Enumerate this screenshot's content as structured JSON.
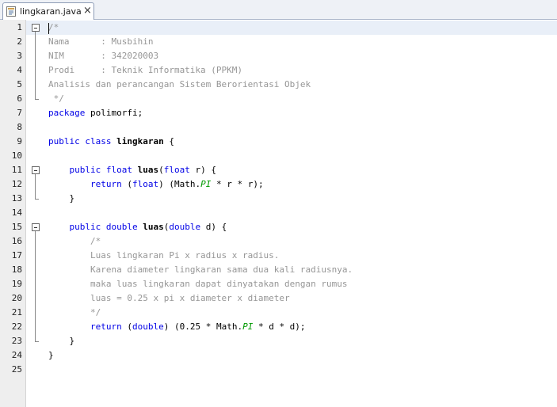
{
  "tab": {
    "filename": "lingkaran.java",
    "close_symbol": "×",
    "icon": "java-file-icon"
  },
  "editor": {
    "current_line": 1,
    "lines": [
      {
        "n": "1",
        "html": "<span class=\"cm\">/*</span>"
      },
      {
        "n": "2",
        "html": "<span class=\"cm\">Nama      : Musbihin</span>"
      },
      {
        "n": "3",
        "html": "<span class=\"cm\">NIM       : 342020003</span>"
      },
      {
        "n": "4",
        "html": "<span class=\"cm\">Prodi     : Teknik Informatika (PPKM)</span>"
      },
      {
        "n": "5",
        "html": "<span class=\"cm\">Analisis dan perancangan Sistem Berorientasi Objek</span>"
      },
      {
        "n": "6",
        "html": "<span class=\"cm\"> */</span>"
      },
      {
        "n": "7",
        "html": "<span class=\"kw\">package</span> polimorfi;"
      },
      {
        "n": "8",
        "html": ""
      },
      {
        "n": "9",
        "html": "<span class=\"kw\">public class</span> <span class=\"bold\">lingkaran</span> {"
      },
      {
        "n": "10",
        "html": ""
      },
      {
        "n": "11",
        "html": "    <span class=\"kw\">public float</span> <span class=\"bold\">luas</span>(<span class=\"kw\">float</span> r) {"
      },
      {
        "n": "12",
        "html": "        <span class=\"kw\">return</span> (<span class=\"kw\">float</span>) (Math.<span class=\"it\">PI</span> * r * r);"
      },
      {
        "n": "13",
        "html": "    }"
      },
      {
        "n": "14",
        "html": ""
      },
      {
        "n": "15",
        "html": "    <span class=\"kw\">public double</span> <span class=\"bold\">luas</span>(<span class=\"kw\">double</span> d) {"
      },
      {
        "n": "16",
        "html": "        <span class=\"cm\">/*</span>"
      },
      {
        "n": "17",
        "html": "        <span class=\"cm\">Luas lingkaran Pi x radius x radius.</span>"
      },
      {
        "n": "18",
        "html": "        <span class=\"cm\">Karena diameter lingkaran sama dua kali radiusnya.</span>"
      },
      {
        "n": "19",
        "html": "        <span class=\"cm\">maka luas lingkaran dapat dinyatakan dengan rumus</span>"
      },
      {
        "n": "20",
        "html": "        <span class=\"cm\">luas = 0.25 x pi x diameter x diameter</span>"
      },
      {
        "n": "21",
        "html": "        <span class=\"cm\">*/</span>"
      },
      {
        "n": "22",
        "html": "        <span class=\"kw\">return</span> (<span class=\"kw\">double</span>) (0.25 * Math.<span class=\"it\">PI</span> * d * d);"
      },
      {
        "n": "23",
        "html": "    }"
      },
      {
        "n": "24",
        "html": "}"
      },
      {
        "n": "25",
        "html": ""
      }
    ],
    "folds": [
      {
        "start": 1,
        "end": 6
      },
      {
        "start": 11,
        "end": 13
      },
      {
        "start": 15,
        "end": 23
      }
    ]
  }
}
